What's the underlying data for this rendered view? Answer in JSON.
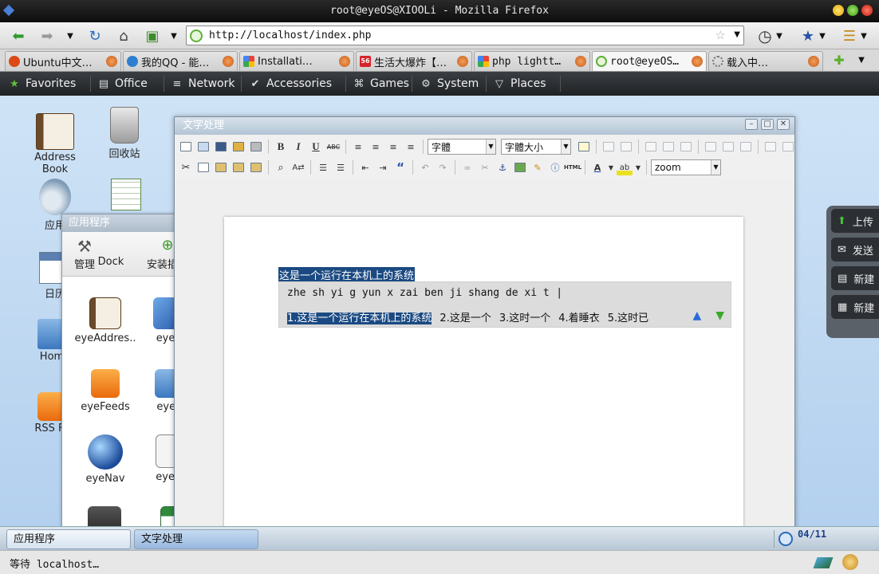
{
  "window": {
    "title": "root@eyeOS@XIOOLi - Mozilla Firefox"
  },
  "nav": {
    "url": "http://localhost/index.php"
  },
  "tabs": [
    {
      "label": "Ubuntu中文…",
      "favicon": "ubuntu-icon",
      "color": "#dd4814"
    },
    {
      "label": "我的QQ - 能…",
      "favicon": "qq-icon",
      "color": "#2f7fd1"
    },
    {
      "label": "Installati…",
      "favicon": "google-icon",
      "color": "#4285f4"
    },
    {
      "label": "生活大爆炸【…",
      "favicon": "56-icon",
      "color": "#d8232a"
    },
    {
      "label": "php lightt…",
      "favicon": "google-icon",
      "color": "#4285f4"
    },
    {
      "label": "root@eyeOS…",
      "favicon": "eyeos-icon",
      "color": "#5fae3d",
      "active": true
    },
    {
      "label": "载入中…",
      "favicon": "loading-icon",
      "color": "#888888"
    }
  ],
  "eyebar": {
    "items": [
      {
        "label": "Favorites",
        "icon": "star-icon"
      },
      {
        "label": "Office",
        "icon": "briefcase-icon"
      },
      {
        "label": "Network",
        "icon": "rss-icon"
      },
      {
        "label": "Accessories",
        "icon": "check-icon"
      },
      {
        "label": "Games",
        "icon": "gamepad-icon"
      },
      {
        "label": "System",
        "icon": "gear-icon"
      },
      {
        "label": "Places",
        "icon": "places-icon"
      }
    ]
  },
  "desktop": {
    "icons": [
      {
        "label": "Address Book"
      },
      {
        "label": "回收站"
      },
      {
        "label": "应用"
      },
      {
        "label": "日历"
      },
      {
        "label": "Home"
      },
      {
        "label": "RSS F.."
      }
    ]
  },
  "appwin": {
    "title": "应用程序",
    "tools": [
      {
        "label": "管理"
      },
      {
        "label": "Dock"
      },
      {
        "label": "安装插件"
      }
    ],
    "apps": [
      {
        "label": "eyeAddres.."
      },
      {
        "label": "eyeB"
      },
      {
        "label": "eyeFeeds"
      },
      {
        "label": "eyeF"
      },
      {
        "label": "eyeNav"
      },
      {
        "label": "eyeN"
      }
    ]
  },
  "editor": {
    "title": "文字处理",
    "font_select": "字體",
    "size_select": "字體大小",
    "zoom_select": "zoom",
    "selected_text": "这是一个运行在本机上的系统",
    "ime": {
      "pinyin": "zhe sh yi g yun x zai ben ji shang de xi t",
      "candidates": [
        {
          "num": "1.",
          "text": "这是一个运行在本机上的系统"
        },
        {
          "num": "2.",
          "text": "这是一个"
        },
        {
          "num": "3.",
          "text": "这时一个"
        },
        {
          "num": "4.",
          "text": "着睡衣"
        },
        {
          "num": "5.",
          "text": "这时已"
        }
      ]
    }
  },
  "sidedock": {
    "items": [
      {
        "label": "上传",
        "icon": "upload-icon"
      },
      {
        "label": "发送",
        "icon": "mail-icon"
      },
      {
        "label": "新建",
        "icon": "new-doc-icon"
      },
      {
        "label": "新建",
        "icon": "new-sheet-icon"
      }
    ]
  },
  "taskbar": {
    "tasks": [
      {
        "label": "应用程序"
      },
      {
        "label": "文字处理"
      }
    ],
    "clock_date": "04/11"
  },
  "status": {
    "text": "等待 localhost…"
  }
}
